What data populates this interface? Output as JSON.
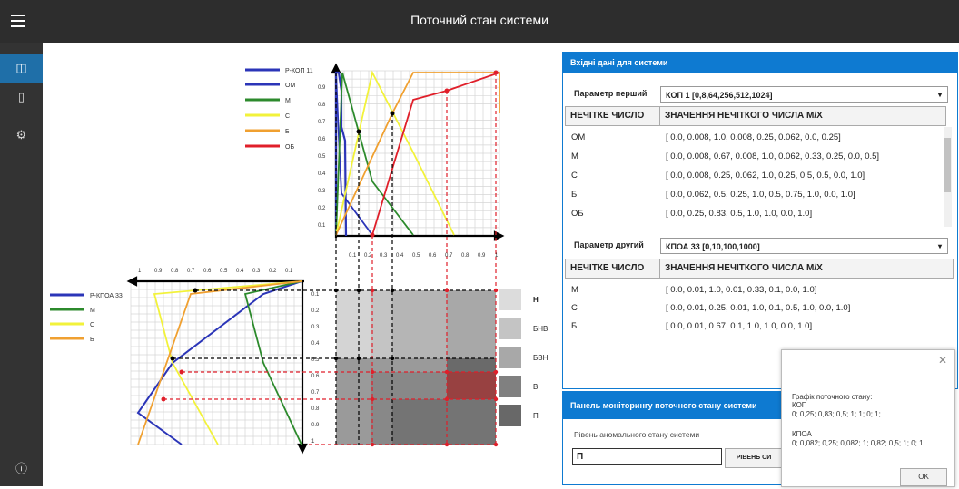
{
  "window": {
    "title": "Поточний стан системи"
  },
  "sidebar": {
    "items": [
      {
        "icon": "chart-icon",
        "glyph": "◫"
      },
      {
        "icon": "document-icon",
        "glyph": "▯"
      },
      {
        "icon": "gear-icon",
        "glyph": "⚙"
      },
      {
        "icon": "info-icon",
        "glyph": "ⓘ"
      }
    ]
  },
  "top_chart": {
    "legend": [
      "Р-КОП 11",
      "ОМ",
      "М",
      "С",
      "Б",
      "ОБ"
    ],
    "y_ticks": [
      "0.9",
      "0.8",
      "0.7",
      "0.6",
      "0.5",
      "0.4",
      "0.3",
      "0.2",
      "0.1"
    ],
    "x_ticks": [
      "0.1",
      "0.2",
      "0.3",
      "0.4",
      "0.5",
      "0.6",
      "0.7",
      "0.8",
      "0.9",
      "1"
    ]
  },
  "left_chart": {
    "legend": [
      "Р-КПОА 33",
      "М",
      "С",
      "Б"
    ],
    "x_ticks": [
      "1",
      "0.9",
      "0.8",
      "0.7",
      "0.6",
      "0.5",
      "0.4",
      "0.3",
      "0.2",
      "0.1"
    ],
    "y_ticks": [
      "0.1",
      "0.2",
      "0.3",
      "0.4",
      "0.5",
      "0.6",
      "0.7",
      "0.8",
      "0.9",
      "1"
    ]
  },
  "levels": [
    {
      "label": "Н",
      "color": "#dcdcdc",
      "bold": true
    },
    {
      "label": "БНВ",
      "color": "#c4c4c4",
      "bold": false
    },
    {
      "label": "БВН",
      "color": "#a8a8a8",
      "bold": false
    },
    {
      "label": "В",
      "color": "#808080",
      "bold": false
    },
    {
      "label": "П",
      "color": "#686868",
      "bold": false
    }
  ],
  "input_panel": {
    "header": "Вхідні дані для системи",
    "param1_label": "Параметр перший",
    "param1_value": "КОП 1 [0,8,64,256,512,1024]",
    "col1": "НЕЧІТКЕ ЧИСЛО",
    "col2": "ЗНАЧЕННЯ НЕЧІТКОГО ЧИСЛА М/Х",
    "rows1": [
      {
        "name": "ОМ",
        "value": "[ 0.0,  0.008,  1.0,  0.008,  0.25,  0.062,  0.0,  0.25]"
      },
      {
        "name": "М",
        "value": "[ 0.0,  0.008,  0.67,  0.008,  1.0,  0.062,  0.33,  0.25,  0.0,  0.5]"
      },
      {
        "name": "С",
        "value": "[ 0.0,  0.008,  0.25,  0.062,  1.0,  0.25,  0.5,  0.5,  0.0,  1.0]"
      },
      {
        "name": "Б",
        "value": "[ 0.0,  0.062,  0.5,  0.25,  1.0,  0.5,  0.75,  1.0,  0.0,  1.0]"
      },
      {
        "name": "ОБ",
        "value": "[ 0.0,  0.25,  0.83,  0.5,  1.0,  1.0,  0.0,  1.0]"
      }
    ],
    "param2_label": "Параметр другий",
    "param2_value": "КПОА 33 [0,10,100,1000]",
    "rows2": [
      {
        "name": "М",
        "value": "[ 0.0,  0.01,  1.0,  0.01,  0.33,  0.1,  0.0,  1.0]"
      },
      {
        "name": "С",
        "value": "[ 0.0,  0.01,  0.25,  0.01,  1.0,  0.1,  0.5,  1.0,  0.0,  1.0]"
      },
      {
        "name": "Б",
        "value": "[ 0.0,  0.01,  0.67,  0.1,  1.0,  1.0,  0.0,  1.0]"
      }
    ]
  },
  "monitor_panel": {
    "header": "Панель моніторингу поточного стану системи",
    "label": "Рівень аномального стану системи",
    "value": "П",
    "button": "РІВЕНЬ СИ"
  },
  "popup": {
    "title": "Графік поточного стану:",
    "kop_label": "КОП",
    "kop_values": "0; 0,25; 0,83; 0,5; 1; 1; 0; 1;",
    "kpoa_label": "КПОА",
    "kpoa_values": "0; 0,082; 0,25; 0,082; 1; 0,82; 0,5; 1; 0; 1;",
    "ok": "OK"
  }
}
